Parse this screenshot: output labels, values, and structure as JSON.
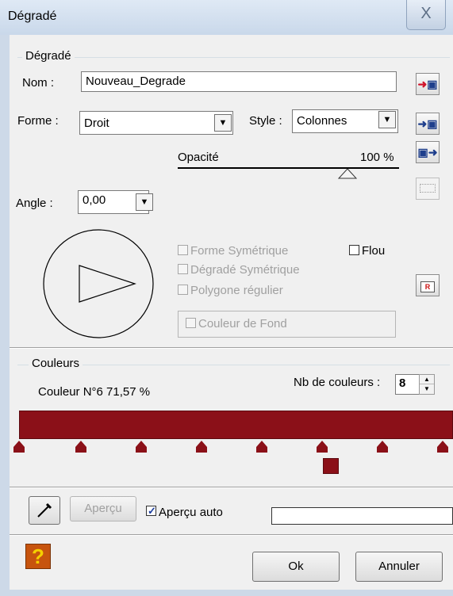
{
  "window": {
    "title": "Dégradé",
    "close_label": "X"
  },
  "gradient_group": {
    "legend": "Dégradé",
    "name_label": "Nom :",
    "name_value": "Nouveau_Degrade",
    "shape_label": "Forme :",
    "shape_value": "Droit",
    "style_label": "Style :",
    "style_value": "Colonnes",
    "opacity_label": "Opacité",
    "opacity_value": "100 %",
    "opacity_level": 100,
    "angle_label": "Angle :",
    "angle_value": "0,00",
    "symmetric_shape": "Forme Symétrique",
    "blur": "Flou",
    "symmetric_gradient": "Dégradé Symétrique",
    "regular_polygon": "Polygone régulier",
    "background_color": "Couleur de Fond"
  },
  "colors_group": {
    "legend": "Couleurs",
    "current_color": "Couleur N°6 71,57 %",
    "count_label": "Nb de couleurs :",
    "count_value": "8",
    "bar_color": "#8b1018",
    "stop_count": 8,
    "selected_stop": 6
  },
  "footer": {
    "preview_button": "Aperçu",
    "auto_preview": "Aperçu auto",
    "auto_preview_checked": true,
    "ok_button": "Ok",
    "cancel_button": "Annuler"
  },
  "icons": [
    "save-icon",
    "load-icon",
    "export-icon",
    "selection-icon",
    "apply-icon",
    "eyedropper-icon",
    "help-icon"
  ]
}
